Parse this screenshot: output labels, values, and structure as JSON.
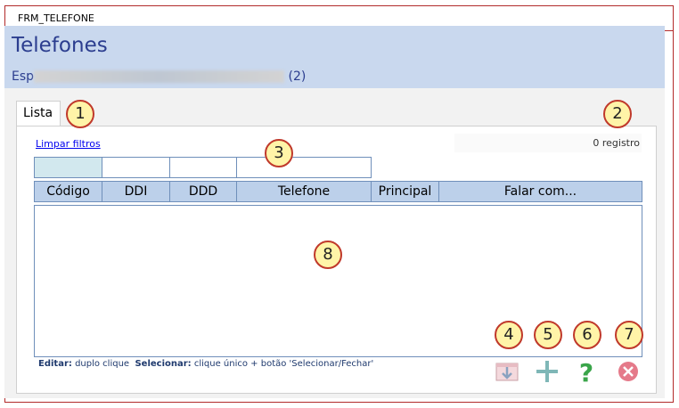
{
  "window": {
    "title": "FRM_TELEFONE"
  },
  "header": {
    "title": "Telefones",
    "subtitle_prefix": "Esp",
    "subtitle_count": "(2)"
  },
  "tabs": [
    {
      "label": "Lista"
    }
  ],
  "filters": {
    "clear_label": "Limpar filtros",
    "record_count": "0 registro"
  },
  "grid": {
    "columns": [
      "Código",
      "DDI",
      "DDD",
      "Telefone",
      "Principal",
      "Falar com..."
    ],
    "rows": []
  },
  "hint": {
    "edit_label": "Editar:",
    "edit_text": "duplo clique",
    "select_label": "Selecionar:",
    "select_text": "clique único + botão 'Selecionar/Fechar'"
  },
  "toolbar": {
    "icons": [
      "export-icon",
      "add-icon",
      "help-icon",
      "close-icon"
    ],
    "colors": {
      "help": "#3aa54a",
      "close": "#e57a8a",
      "add": "#7fb7b7"
    }
  },
  "callouts": [
    "1",
    "2",
    "3",
    "4",
    "5",
    "6",
    "7",
    "8"
  ]
}
